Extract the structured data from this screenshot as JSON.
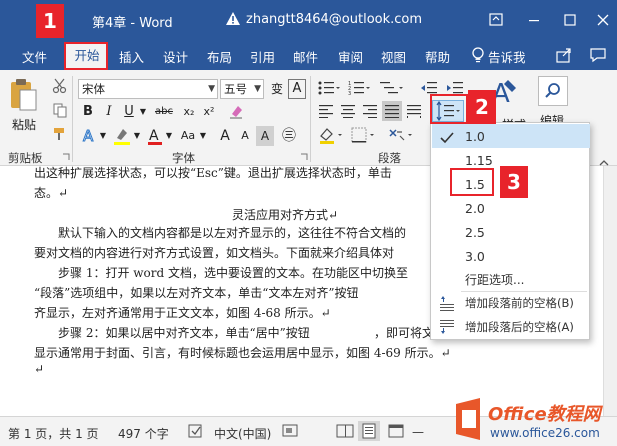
{
  "titlebar": {
    "doc_title": "第4章 - Word",
    "account": "zhangtt8464@outlook.com"
  },
  "tabs": [
    "文件",
    "开始",
    "插入",
    "设计",
    "布局",
    "引用",
    "邮件",
    "审阅",
    "视图",
    "帮助"
  ],
  "tell_me": "告诉我",
  "ribbon": {
    "paste_label": "粘贴",
    "font_name": "宋体",
    "font_size": "五号",
    "wen_glyph": "变",
    "a_glyph": "A",
    "bold": "B",
    "italic": "I",
    "underline": "U",
    "strike": "abc",
    "subscript": "x₂",
    "superscript": "x²",
    "grow_font": "A",
    "shrink_font": "A",
    "change_case": "Aa",
    "char_border": "A",
    "enclose": "㊂",
    "groups": {
      "clipboard": "剪贴板",
      "font": "字体",
      "paragraph": "段落"
    },
    "styles_partial": "样式",
    "edit_label": "编辑"
  },
  "line_spacing_menu": {
    "options": [
      "1.0",
      "1.15",
      "1.5",
      "2.0",
      "2.5",
      "3.0"
    ],
    "selected": "1.0",
    "line_spacing_options": "行距选项...",
    "add_before": "增加段落前的空格(B)",
    "add_after": "增加段落后的空格(A)"
  },
  "document": {
    "line1": "出这种扩展选择状态，可以按“Esc”键。退出扩展选择状态时，单击",
    "line2": "态。↵",
    "title": "灵活应用对齐方式↵",
    "p1_l1": "默认下输入的文档内容都是以左对齐显示的，这往往不符合文档的",
    "p1_l2": "要对文档的内容进行对齐方式设置，如文档头。下面就来介绍具体对",
    "p2_l1": "步骤 1：打开 word 文档，选中要设置的文本。在功能区中切换至",
    "p2_l2": "“段落”选项组中，如果以左对齐文本，单击“文本左对齐”按钮",
    "p2_l3": "齐显示，左对齐通常用于正文文本，如图 4-68 所示。↵",
    "p3_l1": "步骤 2：如果以居中对齐文本，单击“居中”按钮",
    "p3_l1b": "，即可将文本",
    "p3_l2": "显示通常用于封面、引言，有时候标题也会运用居中显示，如图 4-69 所示。↵",
    "p4": "↵"
  },
  "statusbar": {
    "page": "第 1 页，共 1 页",
    "words": "497 个字",
    "language": "中文(中国)"
  },
  "annotations": [
    "1",
    "2",
    "3"
  ],
  "watermark": {
    "brand": "Office教程网",
    "url": "www.office26.com"
  },
  "colors": {
    "title_blue": "#2b579a",
    "annotation_red": "#e8242b",
    "selection_blue": "#cde4f7"
  }
}
